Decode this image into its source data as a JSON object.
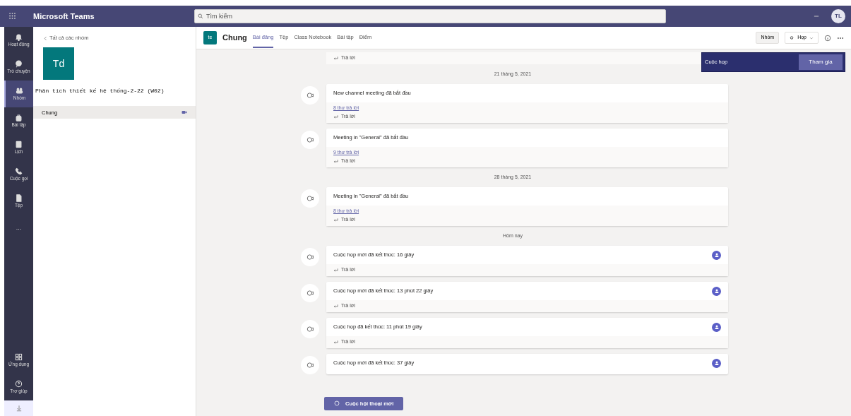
{
  "app_bar": {
    "title": "Microsoft Teams",
    "search": {
      "placeholder": "Tìm kiếm"
    },
    "avatar": "TL"
  },
  "rail": [
    {
      "label": "Hoạt động",
      "selected": false
    },
    {
      "label": "Trò chuyện",
      "selected": false
    },
    {
      "label": "Nhóm",
      "selected": true
    },
    {
      "label": "Bài tập",
      "selected": false
    },
    {
      "label": "Lịch",
      "selected": false
    },
    {
      "label": "Cuộc gọi",
      "selected": false
    },
    {
      "label": "Tệp",
      "selected": false
    },
    {
      "label": "...",
      "selected": false
    }
  ],
  "rail_bottom": [
    {
      "label": "Ứng dụng"
    },
    {
      "label": "Trợ giúp"
    }
  ],
  "team_panel": {
    "back": "Tất cả các nhóm",
    "team_initials": "Td",
    "team_name": "Phân tích thiết kế hệ thống-2-22 (W02)",
    "channels": [
      {
        "name": "Chung",
        "selected": true
      }
    ]
  },
  "channel_header": {
    "initials": "te",
    "name": "Chung",
    "tabs": [
      {
        "label": "Bài đăng",
        "selected": true
      },
      {
        "label": "Tệp",
        "selected": false
      },
      {
        "label": "Class Notebook",
        "selected": false
      },
      {
        "label": "Bài tập",
        "selected": false
      },
      {
        "label": "Điểm",
        "selected": false
      }
    ],
    "team_button": "Nhóm",
    "meet_button": "Họp"
  },
  "meeting_banner": {
    "label": "Cuộc họp",
    "join": "Tham gia"
  },
  "feed": [
    {
      "kind": "reply_only",
      "reply": "Trả lời"
    },
    {
      "kind": "date",
      "label": "21 tháng 5, 2021"
    },
    {
      "kind": "post",
      "title": "New channel meeting đã bắt đầu",
      "replies": "8 thư trả lời",
      "reply": "Trả lời",
      "ended": false
    },
    {
      "kind": "post",
      "title": "Meeting in \"General\" đã bắt đầu",
      "replies": "9 thư trả lời",
      "reply": "Trả lời",
      "ended": false
    },
    {
      "kind": "date",
      "label": "28 tháng 5, 2021"
    },
    {
      "kind": "post",
      "title": "Meeting in \"General\" đã bắt đầu",
      "replies": "8 thư trả lời",
      "reply": "Trả lời",
      "ended": false
    },
    {
      "kind": "date",
      "label": "Hôm nay"
    },
    {
      "kind": "post",
      "title": "Cuộc họp mới đã kết thúc: 16 giây",
      "reply": "Trả lời",
      "ended": true
    },
    {
      "kind": "post",
      "title": "Cuộc họp mới đã kết thúc: 13 phút 22 giây",
      "reply": "Trả lời",
      "ended": true
    },
    {
      "kind": "post",
      "title": "Cuộc họp đã kết thúc: 11 phút 19 giây",
      "reply": "Trả lời",
      "ended": true
    },
    {
      "kind": "post",
      "title": "Cuộc họp mới đã kết thúc: 37 giây",
      "ended": true
    }
  ],
  "new_conversation": "Cuộc hội thoại mới"
}
